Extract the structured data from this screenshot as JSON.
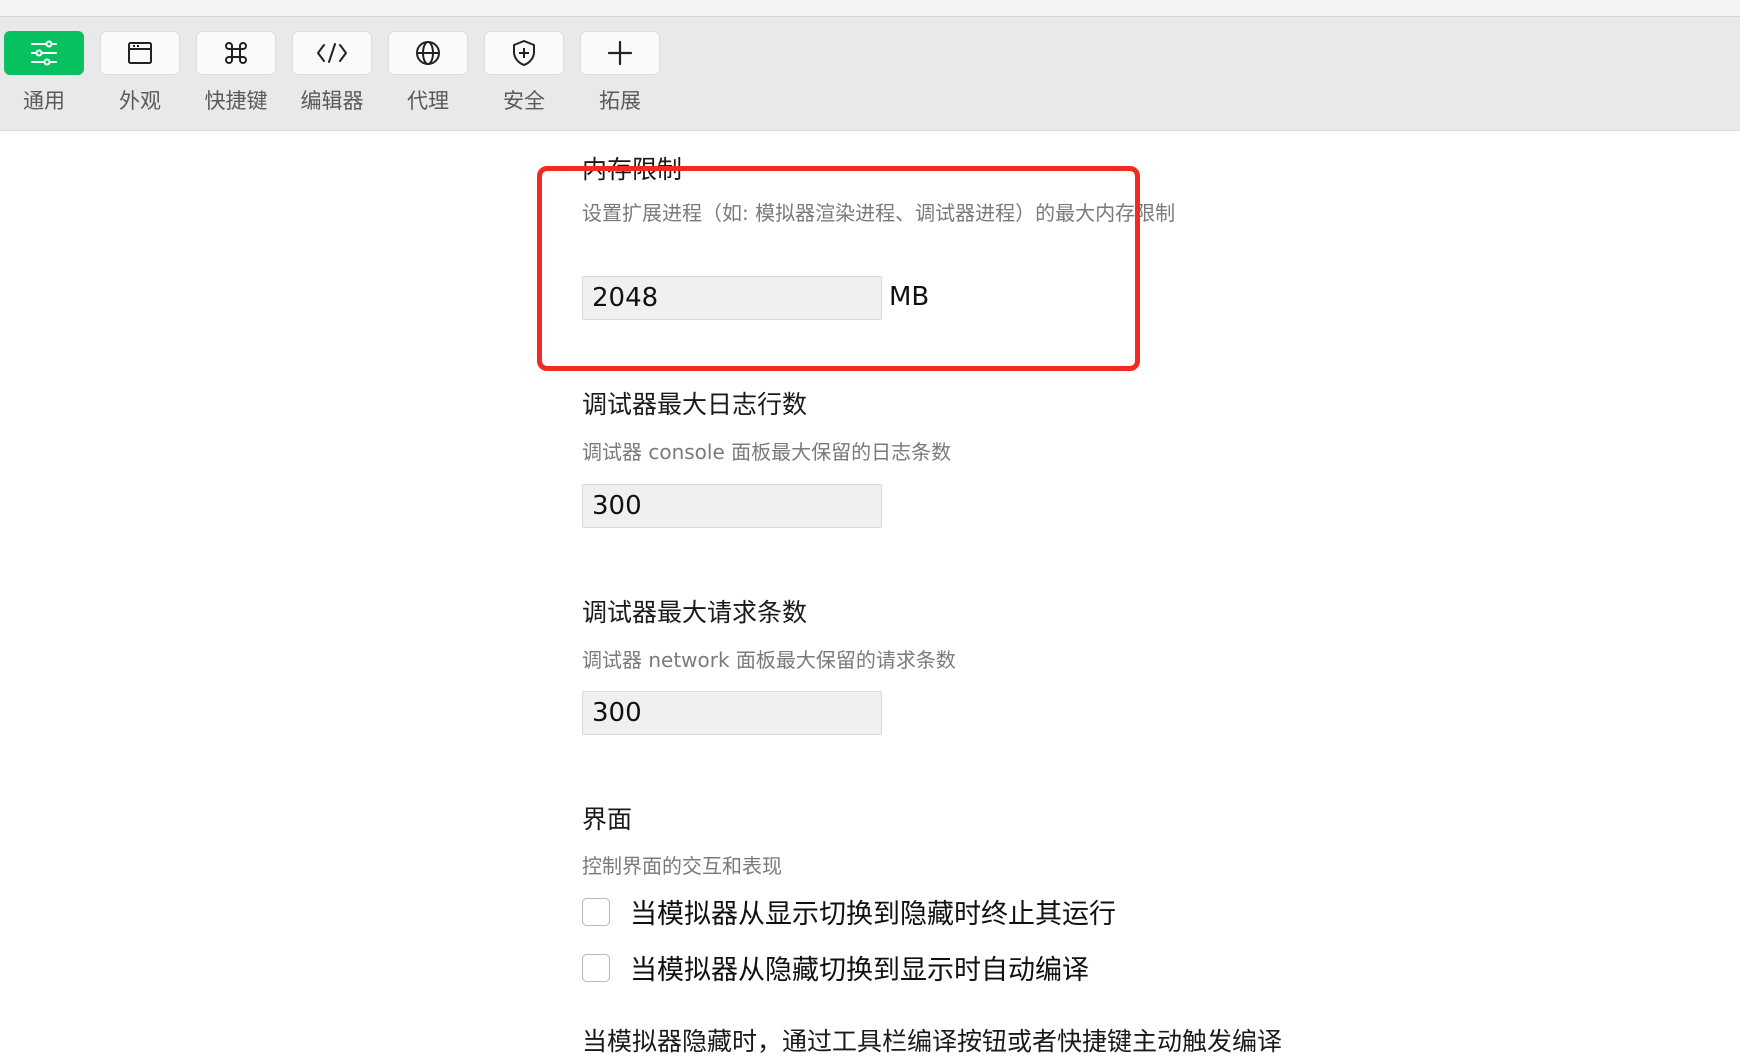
{
  "toolbar": {
    "tabs": [
      {
        "label": "通用",
        "icon": "sliders-icon",
        "active": true
      },
      {
        "label": "外观",
        "icon": "window-icon",
        "active": false
      },
      {
        "label": "快捷键",
        "icon": "command-key-icon",
        "active": false
      },
      {
        "label": "编辑器",
        "icon": "code-icon",
        "active": false
      },
      {
        "label": "代理",
        "icon": "globe-icon",
        "active": false
      },
      {
        "label": "安全",
        "icon": "shield-icon",
        "active": false
      },
      {
        "label": "拓展",
        "icon": "plus-icon",
        "active": false
      }
    ],
    "accent_color": "#07c160"
  },
  "memory_limit": {
    "title": "内存限制",
    "description": "设置扩展进程（如: 模拟器渲染进程、调试器进程）的最大内存限制",
    "value": "2048",
    "unit": "MB"
  },
  "max_log_lines": {
    "title": "调试器最大日志行数",
    "description": "调试器 console 面板最大保留的日志条数",
    "value": "300"
  },
  "max_requests": {
    "title": "调试器最大请求条数",
    "description": "调试器 network 面板最大保留的请求条数",
    "value": "300"
  },
  "interface": {
    "title": "界面",
    "description": "控制界面的交互和表现",
    "options": [
      {
        "label": "当模拟器从显示切换到隐藏时终止其运行",
        "checked": false
      },
      {
        "label": "当模拟器从隐藏切换到显示时自动编译",
        "checked": false
      }
    ],
    "trailing_text": "当模拟器隐藏时，通过工具栏编译按钮或者快捷键主动触发编译"
  },
  "highlight_color": "#f12b23"
}
